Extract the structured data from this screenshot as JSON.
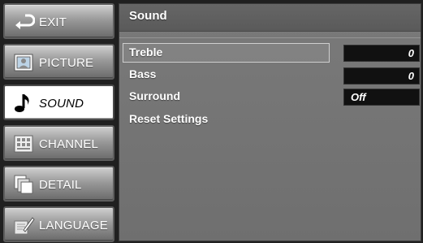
{
  "nav": {
    "items": [
      {
        "id": "exit",
        "label": "EXIT",
        "icon": "exit-arrow-icon"
      },
      {
        "id": "picture",
        "label": "PICTURE",
        "icon": "picture-icon"
      },
      {
        "id": "sound",
        "label": "SOUND",
        "icon": "music-note-icon",
        "active": true
      },
      {
        "id": "channel",
        "label": "CHANNEL",
        "icon": "channel-grid-icon"
      },
      {
        "id": "detail",
        "label": "DETAIL",
        "icon": "detail-pages-icon"
      },
      {
        "id": "language",
        "label": "LANGUAGE",
        "icon": "language-pen-icon"
      }
    ]
  },
  "panel": {
    "title": "Sound",
    "rows": [
      {
        "label": "Treble",
        "value": "0",
        "selected": true
      },
      {
        "label": "Bass",
        "value": "0"
      },
      {
        "label": "Surround",
        "value": "Off"
      },
      {
        "label": "Reset Settings"
      }
    ]
  },
  "colors": {
    "panel_bg": "#737373",
    "value_box_bg": "#111111",
    "nav_active_bg": "#ffffff"
  }
}
